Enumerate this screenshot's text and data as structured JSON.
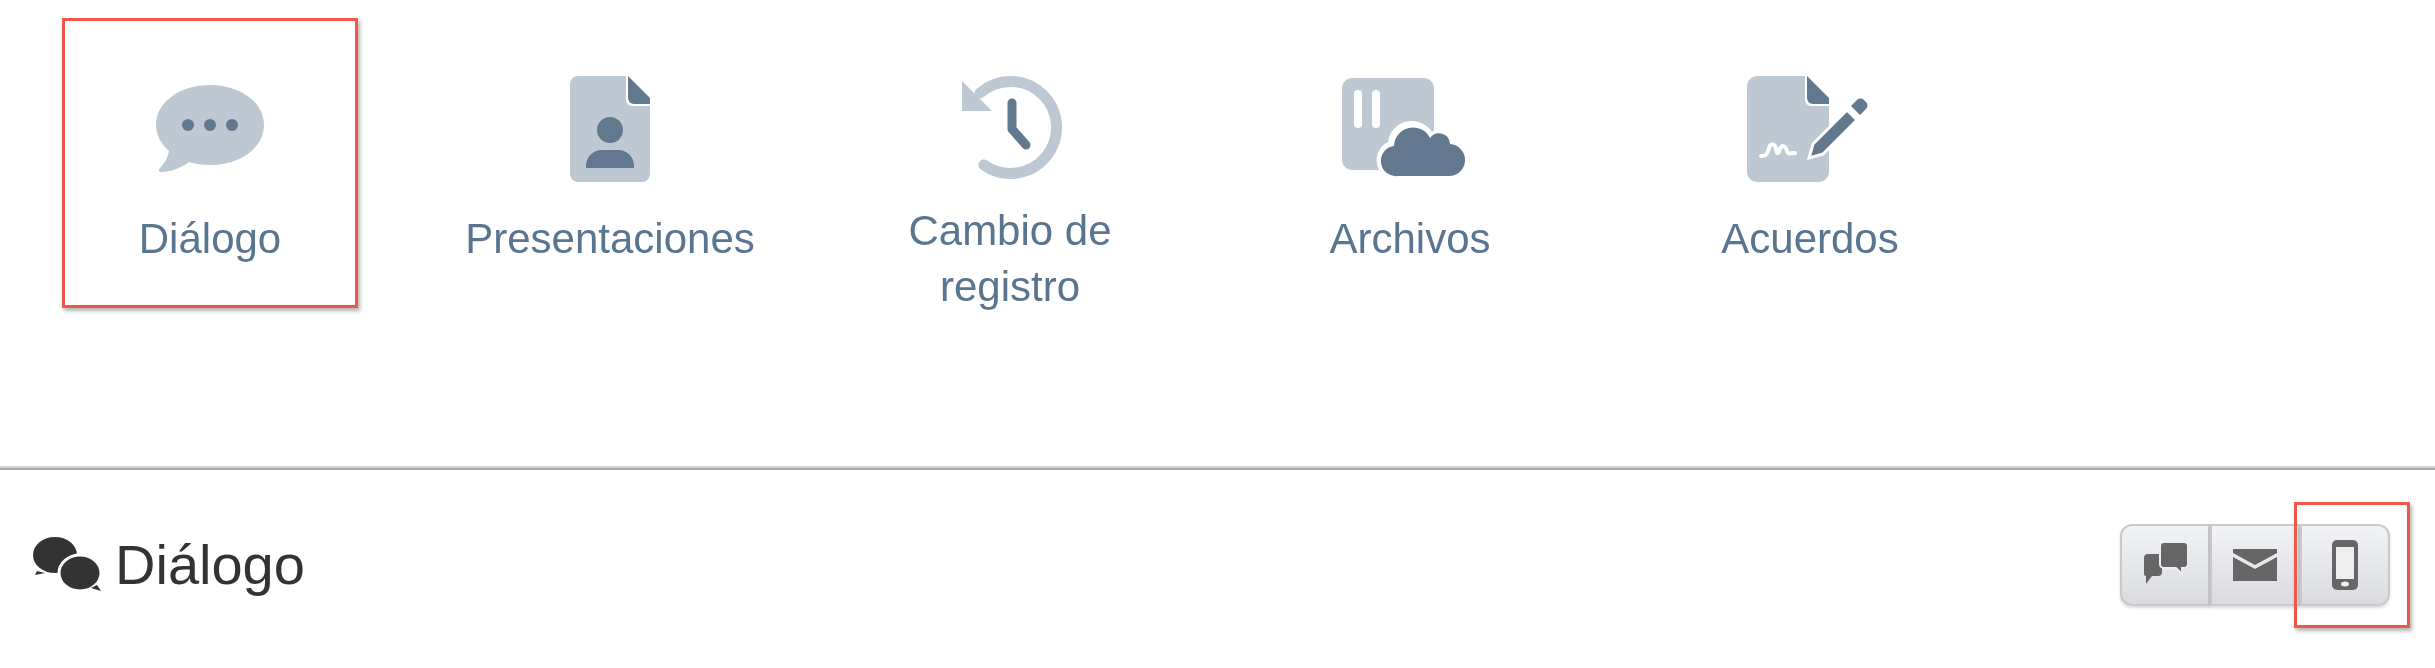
{
  "apps": [
    {
      "label": "Diálogo",
      "kind": "dialog",
      "highlighted": true
    },
    {
      "label": "Presentaciones",
      "kind": "presentation",
      "highlighted": false
    },
    {
      "label": "Cambio de registro",
      "kind": "history",
      "highlighted": false
    },
    {
      "label": "Archivos",
      "kind": "files",
      "highlighted": false
    },
    {
      "label": "Acuerdos",
      "kind": "agreements",
      "highlighted": false
    }
  ],
  "section": {
    "title": "Diálogo"
  },
  "channel_buttons": [
    {
      "kind": "chat",
      "highlighted": false
    },
    {
      "kind": "mail",
      "highlighted": false
    },
    {
      "kind": "phone",
      "highlighted": true
    }
  ]
}
